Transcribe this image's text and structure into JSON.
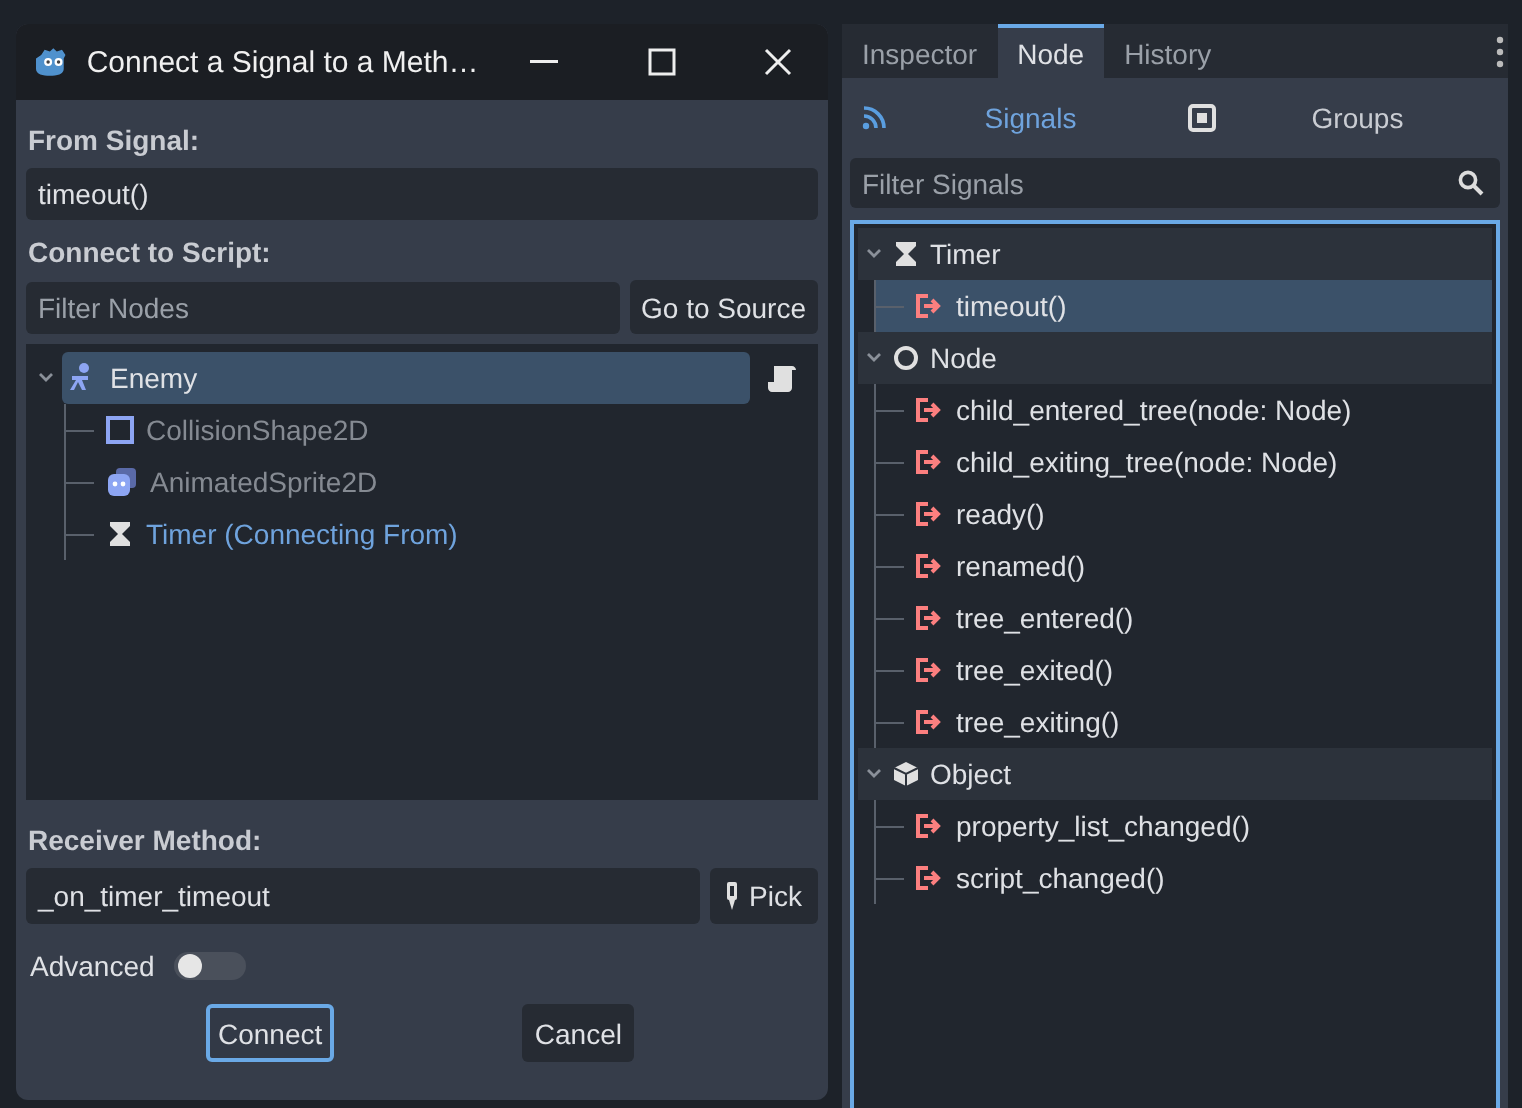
{
  "dialog": {
    "title": "Connect a Signal to a Meth…",
    "from_signal_label": "From Signal:",
    "from_signal_value": "timeout()",
    "connect_label": "Connect to Script:",
    "filter_placeholder": "Filter Nodes",
    "go_to_source": "Go to Source",
    "root": {
      "name": "Enemy",
      "kind": "character",
      "selected": true,
      "has_script": true,
      "children": [
        {
          "name": "CollisionShape2D",
          "kind": "shape",
          "disabled": true,
          "highlighted": false
        },
        {
          "name": "AnimatedSprite2D",
          "kind": "sprite",
          "disabled": true,
          "highlighted": false
        },
        {
          "name": "Timer (Connecting From)",
          "kind": "timer",
          "disabled": false,
          "highlighted": true
        }
      ]
    },
    "receiver_label": "Receiver Method:",
    "receiver_value": "_on_timer_timeout",
    "pick": "Pick",
    "advanced": {
      "label": "Advanced",
      "on": false
    },
    "buttons": [
      {
        "label": "Connect",
        "focused": true
      },
      {
        "label": "Cancel",
        "focused": false
      }
    ]
  },
  "panel": {
    "tabs": [
      {
        "label": "Inspector",
        "selected": false
      },
      {
        "label": "Node",
        "selected": true
      },
      {
        "label": "History",
        "selected": false
      }
    ],
    "subtabs": [
      {
        "label": "Signals",
        "kind": "signals",
        "selected": true
      },
      {
        "label": "Groups",
        "kind": "groups",
        "selected": false
      }
    ],
    "filter_placeholder": "Filter Signals",
    "groups": [
      {
        "name": "Timer",
        "kind": "timer",
        "expanded": true,
        "signals": [
          {
            "name": "timeout()",
            "selected": true
          }
        ]
      },
      {
        "name": "Node",
        "kind": "node",
        "expanded": true,
        "signals": [
          {
            "name": "child_entered_tree(node: Node)",
            "selected": false
          },
          {
            "name": "child_exiting_tree(node: Node)",
            "selected": false
          },
          {
            "name": "ready()",
            "selected": false
          },
          {
            "name": "renamed()",
            "selected": false
          },
          {
            "name": "tree_entered()",
            "selected": false
          },
          {
            "name": "tree_exited()",
            "selected": false
          },
          {
            "name": "tree_exiting()",
            "selected": false
          }
        ]
      },
      {
        "name": "Object",
        "kind": "object",
        "expanded": true,
        "signals": [
          {
            "name": "property_list_changed()",
            "selected": false
          },
          {
            "name": "script_changed()",
            "selected": false
          }
        ]
      }
    ]
  }
}
